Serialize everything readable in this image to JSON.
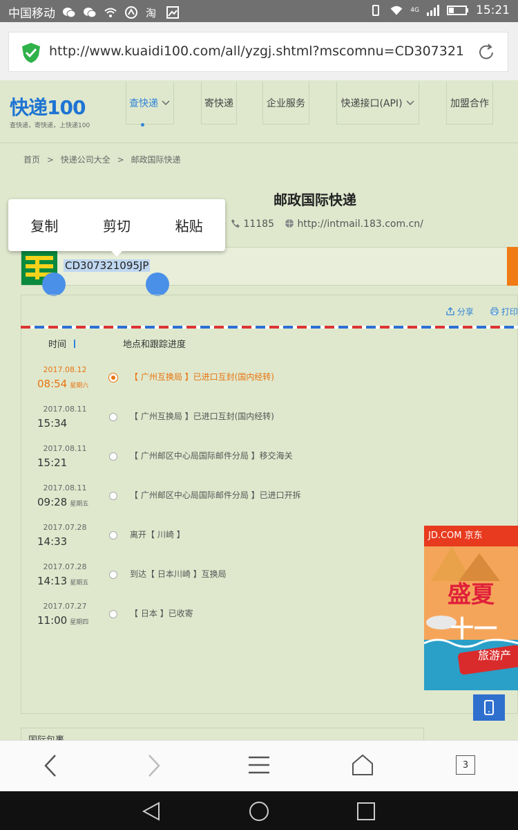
{
  "status_bar": {
    "carrier": "中国移动",
    "network": "4G",
    "time": "15:21"
  },
  "url_bar": {
    "url": "http://www.kuaidi100.com/all/yzgj.shtml?mscomnu=CD307321…"
  },
  "site": {
    "logo_text": "快递100",
    "logo_tagline": "查快递，寄快递，上快递100",
    "nav": [
      {
        "label": "查快递"
      },
      {
        "label": "寄快递"
      },
      {
        "label": "企业服务"
      },
      {
        "label": "快递接口(API)"
      },
      {
        "label": "加盟合作"
      }
    ]
  },
  "breadcrumb": {
    "home": "首页",
    "sep": ">",
    "directory": "快递公司大全",
    "current": "邮政国际快递"
  },
  "company": {
    "title": "邮政国际快递",
    "phone": "11185",
    "website": "http://intmail.183.com.cn/"
  },
  "context_menu": {
    "copy": "复制",
    "cut": "剪切",
    "paste": "粘贴"
  },
  "tracking": {
    "number": "CD307321095JP",
    "share": "分享",
    "print": "打印",
    "col_time": "时间",
    "col_location": "地点和跟踪进度",
    "rows": [
      {
        "date": "2017.08.12",
        "time": "08:54",
        "weekday": "星期六",
        "desc": "【 广州互换局 】已进口互封(国内经转)"
      },
      {
        "date": "2017.08.11",
        "time": "15:34",
        "weekday": "",
        "desc": "【 广州互换局 】已进口互封(国内经转)"
      },
      {
        "date": "2017.08.11",
        "time": "15:21",
        "weekday": "",
        "desc": "【 广州邮区中心局国际邮件分局 】移交海关"
      },
      {
        "date": "2017.08.11",
        "time": "09:28",
        "weekday": "星期五",
        "desc": "【 广州邮区中心局国际邮件分局 】已进口开拆"
      },
      {
        "date": "2017.07.28",
        "time": "14:33",
        "weekday": "",
        "desc": "离开【 川崎 】"
      },
      {
        "date": "2017.07.28",
        "time": "14:13",
        "weekday": "星期五",
        "desc": "到达【 日本川崎 】互换局"
      },
      {
        "date": "2017.07.27",
        "time": "11:00",
        "weekday": "星期四",
        "desc": "【 日本 】已收寄"
      }
    ]
  },
  "ad": {
    "brand": "JD.COM 京东",
    "headline1": "盛夏",
    "headline2": "十一",
    "ribbon": "旅游产"
  },
  "bottom_panel": {
    "title": "国际包裹"
  },
  "browser_toolbar": {
    "tab_count": "3"
  },
  "colors": {
    "accent": "#2f84d8",
    "highlight": "#e8730f",
    "page_bg": "#dfe8cd"
  }
}
